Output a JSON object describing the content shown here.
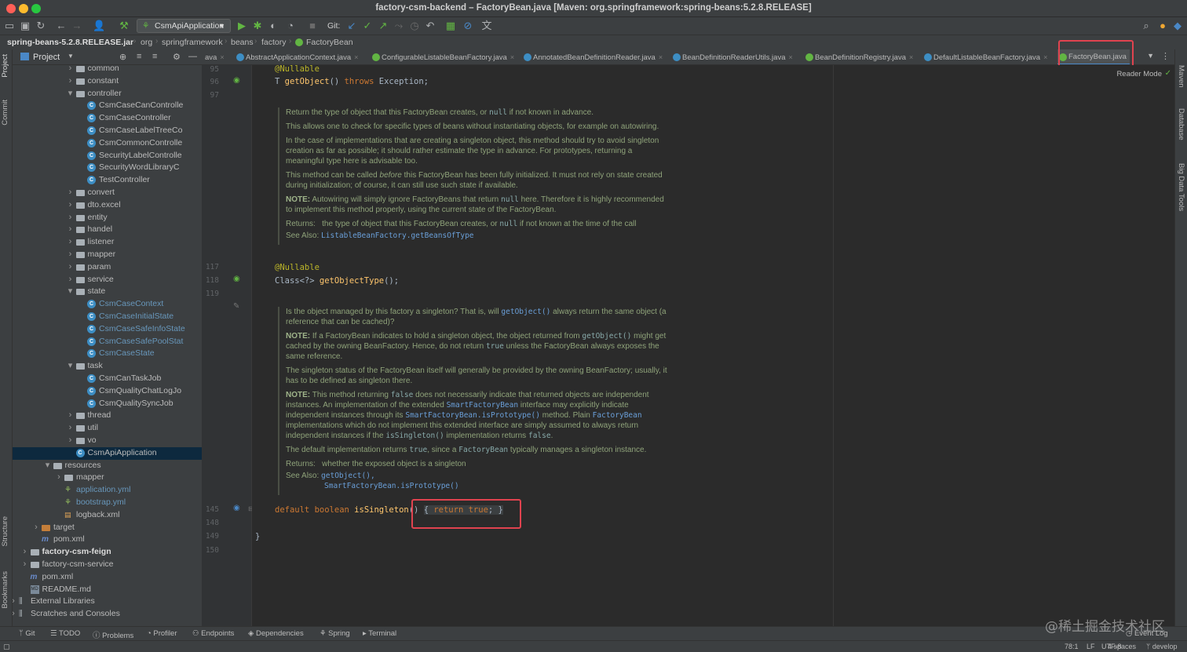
{
  "window": {
    "title": "factory-csm-backend – FactoryBean.java [Maven: org.springframework:spring-beans:5.2.8.RELEASE]"
  },
  "toolbar": {
    "run_config": "CsmApiApplication",
    "git_label": "Git:"
  },
  "breadcrumbs": [
    "spring-beans-5.2.8.RELEASE.jar",
    "org",
    "springframework",
    "beans",
    "factory",
    "FactoryBean"
  ],
  "left_tool_tabs": [
    "Project",
    "Commit",
    "Structure",
    "Bookmarks"
  ],
  "right_tool_tabs": [
    "Maven",
    "Database",
    "Big Data Tools"
  ],
  "project": {
    "title": "Project",
    "tree": [
      {
        "label": "common",
        "kind": "folder",
        "depth": 5,
        "arrow": "collapsed"
      },
      {
        "label": "constant",
        "kind": "folder",
        "depth": 5,
        "arrow": "collapsed"
      },
      {
        "label": "controller",
        "kind": "folder",
        "depth": 5,
        "arrow": "expanded"
      },
      {
        "label": "CsmCaseCanControlle",
        "kind": "class",
        "depth": 6
      },
      {
        "label": "CsmCaseController",
        "kind": "class",
        "depth": 6
      },
      {
        "label": "CsmCaseLabelTreeCo",
        "kind": "class",
        "depth": 6
      },
      {
        "label": "CsmCommonControlle",
        "kind": "class",
        "depth": 6
      },
      {
        "label": "SecurityLabelControlle",
        "kind": "class",
        "depth": 6
      },
      {
        "label": "SecurityWordLibraryC",
        "kind": "class",
        "depth": 6
      },
      {
        "label": "TestController",
        "kind": "class",
        "depth": 6
      },
      {
        "label": "convert",
        "kind": "folder",
        "depth": 5,
        "arrow": "collapsed"
      },
      {
        "label": "dto.excel",
        "kind": "folder",
        "depth": 5,
        "arrow": "collapsed"
      },
      {
        "label": "entity",
        "kind": "folder",
        "depth": 5,
        "arrow": "collapsed"
      },
      {
        "label": "handel",
        "kind": "folder",
        "depth": 5,
        "arrow": "collapsed"
      },
      {
        "label": "listener",
        "kind": "folder",
        "depth": 5,
        "arrow": "collapsed"
      },
      {
        "label": "mapper",
        "kind": "folder",
        "depth": 5,
        "arrow": "collapsed"
      },
      {
        "label": "param",
        "kind": "folder",
        "depth": 5,
        "arrow": "collapsed"
      },
      {
        "label": "service",
        "kind": "folder",
        "depth": 5,
        "arrow": "collapsed"
      },
      {
        "label": "state",
        "kind": "folder",
        "depth": 5,
        "arrow": "expanded"
      },
      {
        "label": "CsmCaseContext",
        "kind": "class-blue",
        "depth": 6
      },
      {
        "label": "CsmCaseInitialState",
        "kind": "class-blue",
        "depth": 6
      },
      {
        "label": "CsmCaseSafeInfoState",
        "kind": "class-blue",
        "depth": 6
      },
      {
        "label": "CsmCaseSafePoolStat",
        "kind": "class-blue",
        "depth": 6
      },
      {
        "label": "CsmCaseState",
        "kind": "class-blue",
        "depth": 6
      },
      {
        "label": "task",
        "kind": "folder",
        "depth": 5,
        "arrow": "expanded"
      },
      {
        "label": "CsmCanTaskJob",
        "kind": "class",
        "depth": 6
      },
      {
        "label": "CsmQualityChatLogJo",
        "kind": "class",
        "depth": 6
      },
      {
        "label": "CsmQualitySyncJob",
        "kind": "class",
        "depth": 6
      },
      {
        "label": "thread",
        "kind": "folder",
        "depth": 5,
        "arrow": "collapsed"
      },
      {
        "label": "util",
        "kind": "folder",
        "depth": 5,
        "arrow": "collapsed"
      },
      {
        "label": "vo",
        "kind": "folder",
        "depth": 5,
        "arrow": "collapsed"
      },
      {
        "label": "CsmApiApplication",
        "kind": "class",
        "depth": 5,
        "selected": true
      },
      {
        "label": "resources",
        "kind": "folder",
        "depth": 3,
        "arrow": "expanded"
      },
      {
        "label": "mapper",
        "kind": "folder",
        "depth": 4,
        "arrow": "collapsed"
      },
      {
        "label": "application.yml",
        "kind": "yml",
        "depth": 4
      },
      {
        "label": "bootstrap.yml",
        "kind": "yml",
        "depth": 4
      },
      {
        "label": "logback.xml",
        "kind": "xml",
        "depth": 4
      },
      {
        "label": "target",
        "kind": "folder-orange",
        "depth": 2,
        "arrow": "collapsed"
      },
      {
        "label": "pom.xml",
        "kind": "m",
        "depth": 2
      },
      {
        "label": "factory-csm-feign",
        "kind": "folder-bold",
        "depth": 1,
        "arrow": "collapsed"
      },
      {
        "label": "factory-csm-service",
        "kind": "folder",
        "depth": 1,
        "arrow": "collapsed"
      },
      {
        "label": "pom.xml",
        "kind": "m",
        "depth": 1
      },
      {
        "label": "README.md",
        "kind": "md",
        "depth": 1
      },
      {
        "label": "External Libraries",
        "kind": "lib",
        "depth": 0,
        "arrow": "collapsed"
      },
      {
        "label": "Scratches and Consoles",
        "kind": "lib",
        "depth": 0,
        "arrow": "collapsed"
      }
    ]
  },
  "tabs": [
    {
      "label": "ava",
      "color": "#3d8ec4"
    },
    {
      "label": "AbstractApplicationContext.java",
      "color": "#3d8ec4"
    },
    {
      "label": "ConfigurableListableBeanFactory.java",
      "color": "#62b543"
    },
    {
      "label": "AnnotatedBeanDefinitionReader.java",
      "color": "#3d8ec4"
    },
    {
      "label": "BeanDefinitionReaderUtils.java",
      "color": "#3d8ec4"
    },
    {
      "label": "BeanDefinitionRegistry.java",
      "color": "#62b543"
    },
    {
      "label": "DefaultListableBeanFactory.java",
      "color": "#3d8ec4"
    },
    {
      "label": "FactoryBean.java",
      "color": "#62b543",
      "active": true
    }
  ],
  "editor": {
    "reader_mode": "Reader Mode",
    "line_numbers": [
      "95",
      "96",
      "97",
      "117",
      "118",
      "119",
      "145",
      "148",
      "149",
      "150"
    ],
    "code": {
      "l95": "@Nullable",
      "l96_type": "T ",
      "l96_fn": "getObject",
      "l96_rest": "() ",
      "l96_kw": "throws",
      "l96_end": " Exception;",
      "l117": "@Nullable",
      "l118_a": "Class<?> ",
      "l118_fn": "getObjectType",
      "l118_end": "();",
      "l145_kw1": "default",
      "l145_kw2": " boolean ",
      "l145_fn": "isSingleton",
      "l145_paren": "() ",
      "l145_body_open": "{ ",
      "l145_return": "return",
      "l145_true": " true",
      "l145_body_close": "; }",
      "l149": "}"
    },
    "doc1": {
      "p1_a": "Return the type of object that this FactoryBean creates, or ",
      "p1_null": "null",
      "p1_b": " if not known in advance.",
      "p2": "This allows one to check for specific types of beans without instantiating objects, for example on autowiring.",
      "p3": "In the case of implementations that are creating a singleton object, this method should try to avoid singleton creation as far as possible; it should rather estimate the type in advance. For prototypes, returning a meaningful type here is advisable too.",
      "p4_a": "This method can be called ",
      "p4_em": "before",
      "p4_b": " this FactoryBean has been fully initialized. It must not rely on state created during initialization; of course, it can still use such state if available.",
      "p5_note": "NOTE:",
      "p5_a": " Autowiring will simply ignore FactoryBeans that return ",
      "p5_null": "null",
      "p5_b": " here. Therefore it is highly recommended to implement this method properly, using the current state of the FactoryBean.",
      "returns_label": "Returns:",
      "returns_a": "the type of object that this FactoryBean creates, or ",
      "returns_null": "null",
      "returns_b": " if not known at the time of the call",
      "see_label": "See Also:",
      "see_link": "ListableBeanFactory.getBeansOfType"
    },
    "doc2": {
      "p1_a": "Is the object managed by this factory a singleton? That is, will ",
      "p1_link": "getObject()",
      "p1_b": " always return the same object (a reference that can be cached)?",
      "p2_note": "NOTE:",
      "p2_a": " If a FactoryBean indicates to hold a singleton object, the object returned from ",
      "p2_code": "getObject()",
      "p2_b": " might get cached by the owning BeanFactory. Hence, do not return ",
      "p2_true": "true",
      "p2_c": " unless the FactoryBean always exposes the same reference.",
      "p3": "The singleton status of the FactoryBean itself will generally be provided by the owning BeanFactory; usually, it has to be defined as singleton there.",
      "p4_note": "NOTE:",
      "p4_a": " This method returning ",
      "p4_false": "false",
      "p4_b": " does not necessarily indicate that returned objects are independent instances. An implementation of the extended ",
      "p4_link1": "SmartFactoryBean",
      "p4_c": " interface may explicitly indicate independent instances through its ",
      "p4_link2": "SmartFactoryBean.isPrototype()",
      "p4_d": " method. Plain ",
      "p4_link3": "FactoryBean",
      "p4_e": " implementations which do not implement this extended interface are simply assumed to always return independent instances if the ",
      "p4_code": "isSingleton()",
      "p4_f": " implementation returns ",
      "p4_false2": "false",
      "p4_g": ".",
      "p5_a": "The default implementation returns ",
      "p5_true": "true",
      "p5_b": ", since a ",
      "p5_code": "FactoryBean",
      "p5_c": " typically manages a singleton instance.",
      "returns_label": "Returns:",
      "returns_text": "whether the exposed object is a singleton",
      "see_label": "See Also:",
      "see_link1": "getObject(),",
      "see_link2": "SmartFactoryBean.isPrototype()"
    }
  },
  "bottom_tools": [
    "Git",
    "TODO",
    "Problems",
    "Profiler",
    "Endpoints",
    "Dependencies",
    "Spring",
    "Terminal"
  ],
  "event_log": "Event Log",
  "status": {
    "position": "78:1",
    "line_sep": "LF",
    "encoding": "UTF-8",
    "indent": "4 spaces",
    "branch": "develop"
  },
  "watermark": "@稀土掘金技术社区",
  "colors": {
    "highlight_box": "#e0434f",
    "selection": "#0d293e",
    "accent": "#4a88c7"
  }
}
